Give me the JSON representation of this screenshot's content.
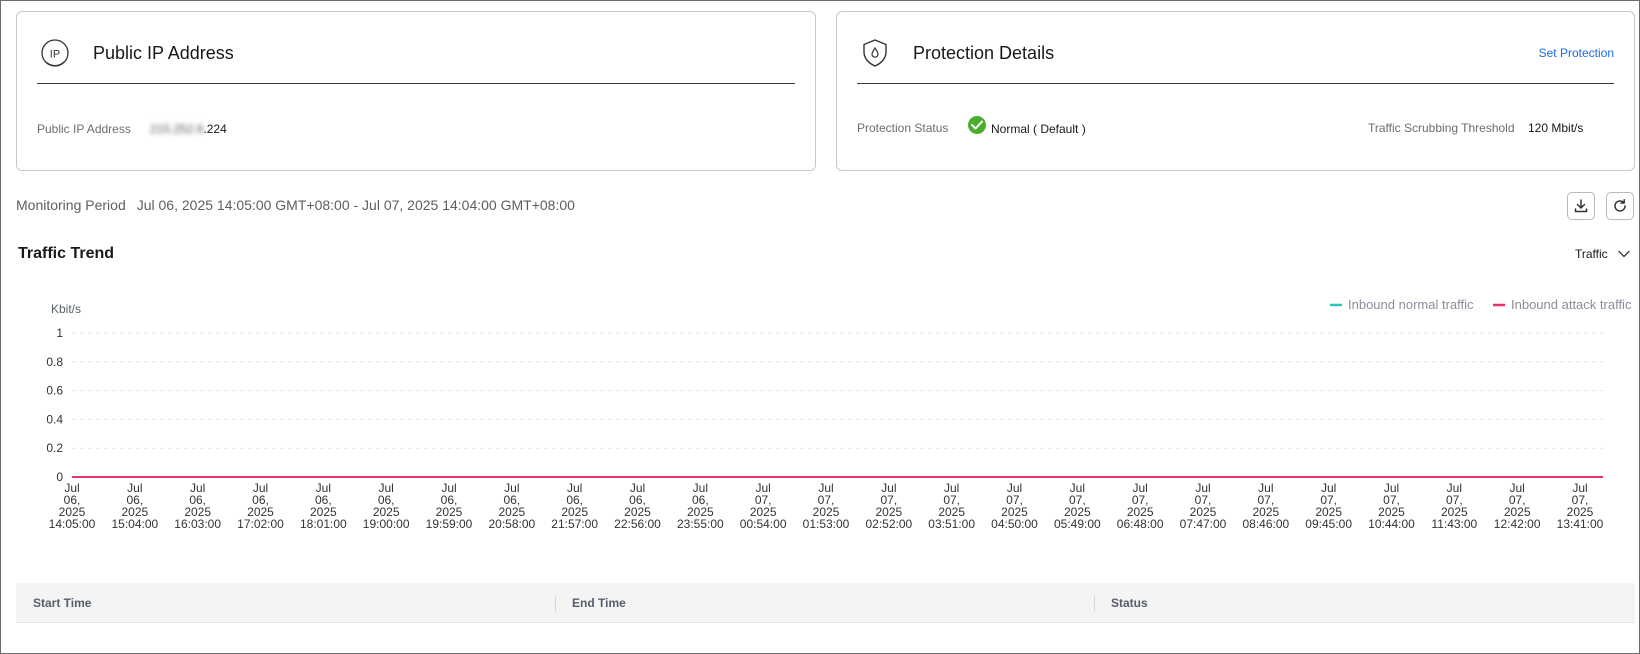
{
  "ip_card": {
    "title": "Public IP Address",
    "icon": "ip-circle-icon",
    "field_label": "Public IP Address",
    "ip_masked": "215.252.6",
    "ip_suffix": ".224"
  },
  "protection_card": {
    "title": "Protection Details",
    "icon": "shield-drop-icon",
    "link": "Set Protection",
    "status_label": "Protection Status",
    "status_value": "Normal ( Default )",
    "threshold_label": "Traffic Scrubbing Threshold",
    "threshold_value": "120 Mbit/s"
  },
  "monitoring": {
    "label": "Monitoring Period",
    "value": "Jul 06, 2025 14:05:00 GMT+08:00 - Jul 07, 2025 14:04:00 GMT+08:00"
  },
  "trend": {
    "title": "Traffic Trend",
    "selector": "Traffic"
  },
  "colors": {
    "normal": "#2ec7b7",
    "attack": "#e8336d",
    "link": "#1a6ce6",
    "ok": "#4cae2f"
  },
  "chart_data": {
    "type": "line",
    "ylabel": "Kbit/s",
    "ylim": [
      0,
      1
    ],
    "yticks": [
      "0",
      "0.2",
      "0.4",
      "0.6",
      "0.8",
      "1"
    ],
    "x": [
      "Jul 06, 2025 14:05:00",
      "Jul 06, 2025 15:04:00",
      "Jul 06, 2025 16:03:00",
      "Jul 06, 2025 17:02:00",
      "Jul 06, 2025 18:01:00",
      "Jul 06, 2025 19:00:00",
      "Jul 06, 2025 19:59:00",
      "Jul 06, 2025 20:58:00",
      "Jul 06, 2025 21:57:00",
      "Jul 06, 2025 22:56:00",
      "Jul 06, 2025 23:55:00",
      "Jul 07, 2025 00:54:00",
      "Jul 07, 2025 01:53:00",
      "Jul 07, 2025 02:52:00",
      "Jul 07, 2025 03:51:00",
      "Jul 07, 2025 04:50:00",
      "Jul 07, 2025 05:49:00",
      "Jul 07, 2025 06:48:00",
      "Jul 07, 2025 07:47:00",
      "Jul 07, 2025 08:46:00",
      "Jul 07, 2025 09:45:00",
      "Jul 07, 2025 10:44:00",
      "Jul 07, 2025 11:43:00",
      "Jul 07, 2025 12:42:00",
      "Jul 07, 2025 13:41:00"
    ],
    "xtick_lines": [
      [
        "Jul",
        "06,",
        "2025",
        "14:05:00"
      ],
      [
        "Jul",
        "06,",
        "2025",
        "15:04:00"
      ],
      [
        "Jul",
        "06,",
        "2025",
        "16:03:00"
      ],
      [
        "Jul",
        "06,",
        "2025",
        "17:02:00"
      ],
      [
        "Jul",
        "06,",
        "2025",
        "18:01:00"
      ],
      [
        "Jul",
        "06,",
        "2025",
        "19:00:00"
      ],
      [
        "Jul",
        "06,",
        "2025",
        "19:59:00"
      ],
      [
        "Jul",
        "06,",
        "2025",
        "20:58:00"
      ],
      [
        "Jul",
        "06,",
        "2025",
        "21:57:00"
      ],
      [
        "Jul",
        "06,",
        "2025",
        "22:56:00"
      ],
      [
        "Jul",
        "06,",
        "2025",
        "23:55:00"
      ],
      [
        "Jul",
        "07,",
        "2025",
        "00:54:00"
      ],
      [
        "Jul",
        "07,",
        "2025",
        "01:53:00"
      ],
      [
        "Jul",
        "07,",
        "2025",
        "02:52:00"
      ],
      [
        "Jul",
        "07,",
        "2025",
        "03:51:00"
      ],
      [
        "Jul",
        "07,",
        "2025",
        "04:50:00"
      ],
      [
        "Jul",
        "07,",
        "2025",
        "05:49:00"
      ],
      [
        "Jul",
        "07,",
        "2025",
        "06:48:00"
      ],
      [
        "Jul",
        "07,",
        "2025",
        "07:47:00"
      ],
      [
        "Jul",
        "07,",
        "2025",
        "08:46:00"
      ],
      [
        "Jul",
        "07,",
        "2025",
        "09:45:00"
      ],
      [
        "Jul",
        "07,",
        "2025",
        "10:44:00"
      ],
      [
        "Jul",
        "07,",
        "2025",
        "11:43:00"
      ],
      [
        "Jul",
        "07,",
        "2025",
        "12:42:00"
      ],
      [
        "Jul",
        "07,",
        "2025",
        "13:41:00"
      ]
    ],
    "series": [
      {
        "name": "Inbound normal traffic",
        "values": [
          0,
          0,
          0,
          0,
          0,
          0,
          0,
          0,
          0,
          0,
          0,
          0,
          0,
          0,
          0,
          0,
          0,
          0,
          0,
          0,
          0,
          0,
          0,
          0,
          0
        ]
      },
      {
        "name": "Inbound attack traffic",
        "values": [
          0,
          0,
          0,
          0,
          0,
          0,
          0,
          0,
          0,
          0,
          0,
          0,
          0,
          0,
          0,
          0,
          0,
          0,
          0,
          0,
          0,
          0,
          0,
          0,
          0
        ]
      }
    ],
    "grid": true,
    "legend": "top-right"
  },
  "table": {
    "columns": [
      "Start Time",
      "End Time",
      "Status"
    ]
  }
}
